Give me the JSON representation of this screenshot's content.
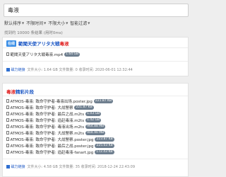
{
  "search": {
    "value": "毒液"
  },
  "filters": [
    {
      "label": "默认排序"
    },
    {
      "label": "不限时间"
    },
    {
      "label": "不限大小"
    },
    {
      "label": "智能过滤"
    }
  ],
  "result_count": "找到约 10000 条结果 (用时0ms)",
  "results": [
    {
      "tag": "在线",
      "title_prefix": "範聞天使アリタ大戦",
      "title_highlight": "毒液",
      "files": [
        {
          "name": "範聞天使アリタ大戦毒液.mp4",
          "size": "1.64 GB"
        }
      ],
      "magnet_label": "磁力链接",
      "meta": "文件大小: 1.64 GB  文件数量: 0  收录时间: 2020-06-01 12:32:44"
    },
    {
      "title_highlight": "毒液",
      "title_rest": "精彩片段",
      "files": [
        {
          "name": "ATMOS-毒液: 致命守护者-毒液出场.poster.jpg",
          "size": "221.87 KB"
        },
        {
          "name": "ATMOS-毒液: 致命守护者: 大战警察",
          "size": "221.87 KB"
        },
        {
          "name": "ATMOS-毒液: 致命守护者: 最后之战.m2ts",
          "size": "1.03 GB"
        },
        {
          "name": "ATMOS-毒液: 致命守护者: 追赶毒液.m2ts",
          "size": "1.42 GB"
        },
        {
          "name": "ATMOS-毒液: 致命守护者: 毒液出场.m2ts",
          "size": "964.88 MB"
        },
        {
          "name": "ATMOS-毒液: 致命守护者: 大战警察.m2ts",
          "size": "904.90 MB"
        },
        {
          "name": "ATMOS-毒液: 致命守护者: 大战警察.poster.jpg",
          "size": "223.87 KB"
        },
        {
          "name": "ATMOS-毒液: 致命守护者: 最后之战.poster.jpg",
          "size": "225.03 KB"
        },
        {
          "name": "ATMOS-毒液: 致命守护者: 追赶毒液-fanart.jpg",
          "size": "172.43 KB"
        }
      ],
      "magnet_label": "磁力链接",
      "meta": "文件大小: 4.58 GB  文件数量: 35  收录时间: 2018-12-24 22:43:09"
    }
  ],
  "colors": {
    "link": "#1a56c4",
    "highlight": "#e02222",
    "size_badge": "#6f7f8f",
    "tag_bg": "#3a8ee6"
  }
}
